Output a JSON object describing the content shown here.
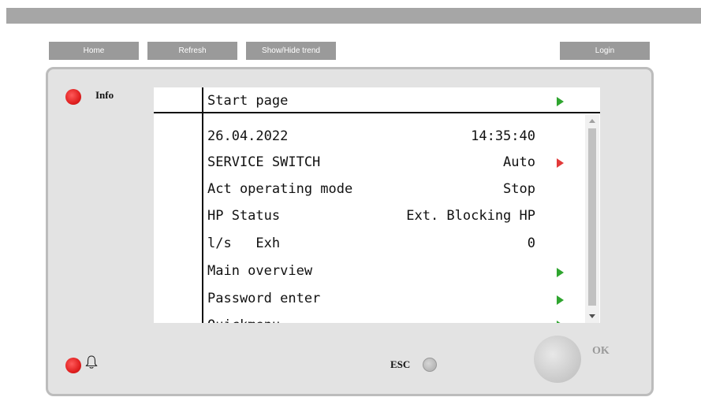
{
  "toolbar": {
    "home_label": "Home",
    "refresh_label": "Refresh",
    "trend_label": "Show/Hide trend",
    "login_label": "Login"
  },
  "panel": {
    "info_label": "Info",
    "esc_label": "ESC",
    "ok_label": "OK",
    "alarm_icon": "bell-icon"
  },
  "screen": {
    "header_title": "Start page",
    "rows": [
      {
        "left": "26.04.2022",
        "right": "14:35:40"
      },
      {
        "left": "SERVICE SWITCH",
        "right": "Auto"
      },
      {
        "left": "Act operating mode",
        "right": "Stop"
      },
      {
        "left": "HP Status",
        "right": "Ext. Blocking HP"
      },
      {
        "left": "l/s   Exh",
        "right": "0"
      },
      {
        "left": "Main overview",
        "right": ""
      },
      {
        "left": "Password enter",
        "right": ""
      },
      {
        "left": "Quickmenu",
        "right": ""
      }
    ]
  },
  "colors": {
    "nav_button": "#9a9a9a",
    "led_red": "#e02020",
    "arrow_green": "#2fa52f",
    "arrow_red": "#e23a3a",
    "panel_bg": "#e3e3e3"
  }
}
